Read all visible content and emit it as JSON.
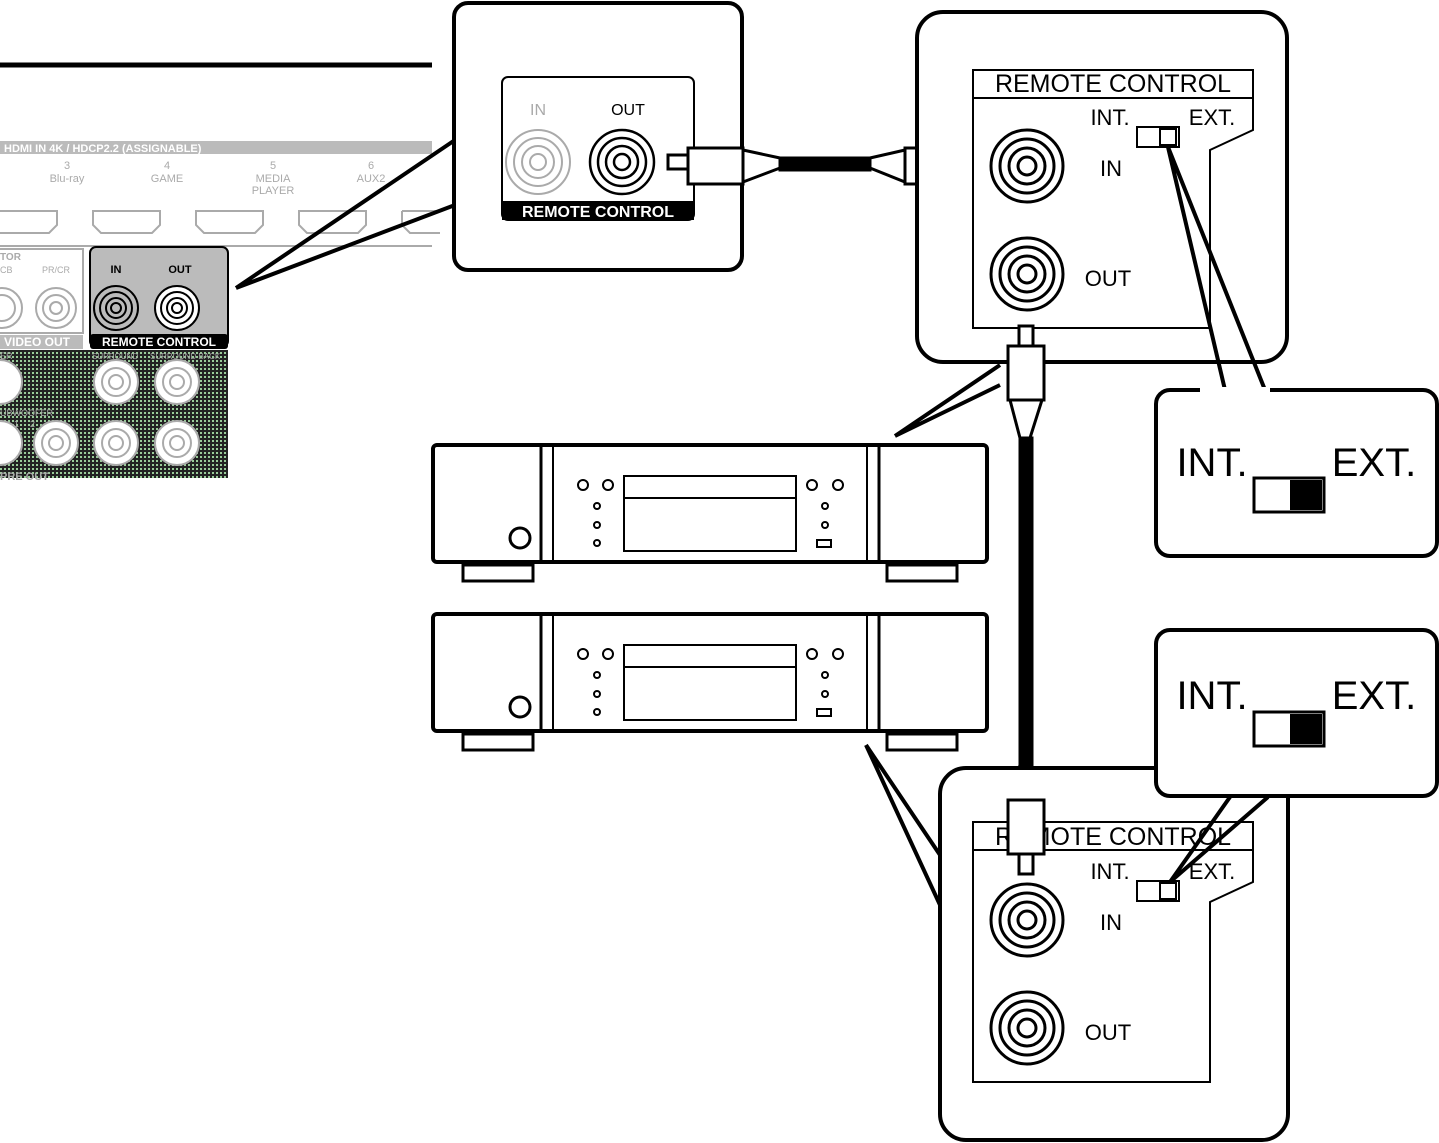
{
  "receiver_panel": {
    "hdmi_header": "HDMI IN 4K / HDCP2.2 (ASSIGNABLE)",
    "hdmi_inputs": [
      {
        "num": "3",
        "name": "Blu-ray",
        "name2": ""
      },
      {
        "num": "4",
        "name": "GAME",
        "name2": ""
      },
      {
        "num": "5",
        "name": "MEDIA",
        "name2": "PLAYER"
      },
      {
        "num": "6",
        "name": "AUX2",
        "name2": ""
      }
    ],
    "monitor_label": "TOR",
    "pb_label": "CB",
    "pr_label": "PR/CR",
    "video_out": "VIDEO OUT",
    "remote_in": "IN",
    "remote_out": "OUT",
    "remote_control": "REMOTE CONTROL",
    "center_label": "ER",
    "surround": "SURROUND",
    "surround_back": "SURROUND BACK",
    "subwoofer": "UBWOOFER",
    "sub1": "1",
    "sub2": "2",
    "pre_out": "PRE OUT"
  },
  "receiver_callout": {
    "in": "IN",
    "out": "OUT",
    "remote_control": "REMOTE CONTROL"
  },
  "device_top": {
    "title": "REMOTE CONTROL",
    "int": "INT.",
    "ext": "EXT.",
    "in": "IN",
    "out": "OUT"
  },
  "switch_callout_top": {
    "int": "INT.",
    "ext": "EXT.",
    "position": "EXT."
  },
  "switch_callout_bottom": {
    "int": "INT.",
    "ext": "EXT.",
    "position": "EXT."
  },
  "device_bottom": {
    "title": "REMOTE CONTROL",
    "int": "INT.",
    "ext": "EXT.",
    "in": "IN",
    "out": "OUT"
  }
}
